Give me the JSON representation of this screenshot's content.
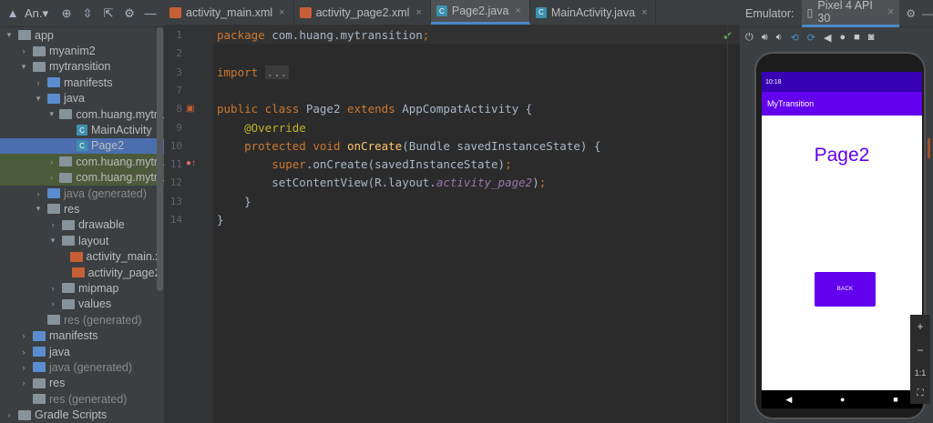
{
  "project": {
    "title": "An.▾",
    "tree": [
      {
        "label": "app",
        "indent": 0,
        "arrow": "▾",
        "icon": "fold"
      },
      {
        "label": "myanim2",
        "indent": 1,
        "arrow": "›",
        "icon": "fold"
      },
      {
        "label": "mytransition",
        "indent": 1,
        "arrow": "▾",
        "icon": "fold"
      },
      {
        "label": "manifests",
        "indent": 2,
        "arrow": "›",
        "icon": "foldj"
      },
      {
        "label": "java",
        "indent": 2,
        "arrow": "▾",
        "icon": "foldj"
      },
      {
        "label": "com.huang.mytra",
        "indent": 3,
        "arrow": "▾",
        "icon": "fold"
      },
      {
        "label": "MainActivity",
        "indent": 4,
        "arrow": "",
        "icon": "cls"
      },
      {
        "label": "Page2",
        "indent": 4,
        "arrow": "",
        "icon": "cls",
        "state": "sel"
      },
      {
        "label": "com.huang.mytra",
        "indent": 3,
        "arrow": "›",
        "icon": "fold",
        "state": "sel2"
      },
      {
        "label": "com.huang.mytra",
        "indent": 3,
        "arrow": "›",
        "icon": "fold",
        "state": "sel2"
      },
      {
        "label": "java (generated)",
        "indent": 2,
        "arrow": "›",
        "icon": "foldj",
        "gen": true
      },
      {
        "label": "res",
        "indent": 2,
        "arrow": "▾",
        "icon": "foldr"
      },
      {
        "label": "drawable",
        "indent": 3,
        "arrow": "›",
        "icon": "fold"
      },
      {
        "label": "layout",
        "indent": 3,
        "arrow": "▾",
        "icon": "fold"
      },
      {
        "label": "activity_main.xı",
        "indent": 4,
        "arrow": "",
        "icon": "xml"
      },
      {
        "label": "activity_page2.",
        "indent": 4,
        "arrow": "",
        "icon": "xml"
      },
      {
        "label": "mipmap",
        "indent": 3,
        "arrow": "›",
        "icon": "fold"
      },
      {
        "label": "values",
        "indent": 3,
        "arrow": "›",
        "icon": "fold"
      },
      {
        "label": "res (generated)",
        "indent": 2,
        "arrow": "",
        "icon": "foldr",
        "gen": true
      },
      {
        "label": "manifests",
        "indent": 1,
        "arrow": "›",
        "icon": "foldj"
      },
      {
        "label": "java",
        "indent": 1,
        "arrow": "›",
        "icon": "foldj"
      },
      {
        "label": "java (generated)",
        "indent": 1,
        "arrow": "›",
        "icon": "foldj",
        "gen": true
      },
      {
        "label": "res",
        "indent": 1,
        "arrow": "›",
        "icon": "foldr"
      },
      {
        "label": "res (generated)",
        "indent": 1,
        "arrow": "",
        "icon": "foldr",
        "gen": true
      },
      {
        "label": "Gradle Scripts",
        "indent": 0,
        "arrow": "›",
        "icon": "fold"
      }
    ]
  },
  "tabs": [
    {
      "label": "activity_main.xml",
      "icon": "xml",
      "close": "×"
    },
    {
      "label": "activity_page2.xml",
      "icon": "xml",
      "close": "×"
    },
    {
      "label": "Page2.java",
      "icon": "cls",
      "close": "×",
      "active": true
    },
    {
      "label": "MainActivity.java",
      "icon": "cls",
      "close": "×"
    }
  ],
  "code": {
    "line_numbers": [
      "1",
      "2",
      "3",
      "7",
      "8",
      "9",
      "10",
      "11",
      "12",
      "13",
      "14"
    ],
    "lines": [
      [
        {
          "t": "package ",
          "c": "kw"
        },
        {
          "t": "com.huang.mytransition",
          "c": ""
        },
        {
          "t": ";",
          "c": "kw"
        }
      ],
      [],
      [
        {
          "t": "import ",
          "c": "kw"
        },
        {
          "t": "...",
          "c": "fold-box"
        }
      ],
      [],
      [
        {
          "t": "public class ",
          "c": "kw"
        },
        {
          "t": "Page2 ",
          "c": ""
        },
        {
          "t": "extends ",
          "c": "kw"
        },
        {
          "t": "AppCompatActivity {",
          "c": ""
        }
      ],
      [
        {
          "t": "    @Override",
          "c": "an"
        }
      ],
      [
        {
          "t": "    protected void ",
          "c": "kw"
        },
        {
          "t": "onCreate",
          "c": "fn"
        },
        {
          "t": "(Bundle savedInstanceState) {",
          "c": ""
        }
      ],
      [
        {
          "t": "        super",
          "c": "kw"
        },
        {
          "t": ".onCreate(savedInstanceState)",
          "c": ""
        },
        {
          "t": ";",
          "c": "kw"
        }
      ],
      [
        {
          "t": "        setContentView(R.layout.",
          "c": ""
        },
        {
          "t": "activity_page2",
          "c": "it"
        },
        {
          "t": ")",
          "c": ""
        },
        {
          "t": ";",
          "c": "kw"
        }
      ],
      [
        {
          "t": "    }",
          "c": ""
        }
      ],
      [
        {
          "t": "}",
          "c": ""
        }
      ]
    ]
  },
  "emulator": {
    "label": "Emulator:",
    "device": "Pixel 4 API 30",
    "close": "×",
    "time": "10:18",
    "app_title": "MyTransition",
    "page_text": "Page2",
    "back_button": "BACK",
    "zoom_in": "+",
    "zoom_out": "−",
    "zoom_ratio": "1:1",
    "nav": [
      "◀",
      "●",
      "■"
    ]
  },
  "colors": {
    "accent": "#4a88c7",
    "app_primary": "#6200ee",
    "app_dark": "#3700b3"
  }
}
